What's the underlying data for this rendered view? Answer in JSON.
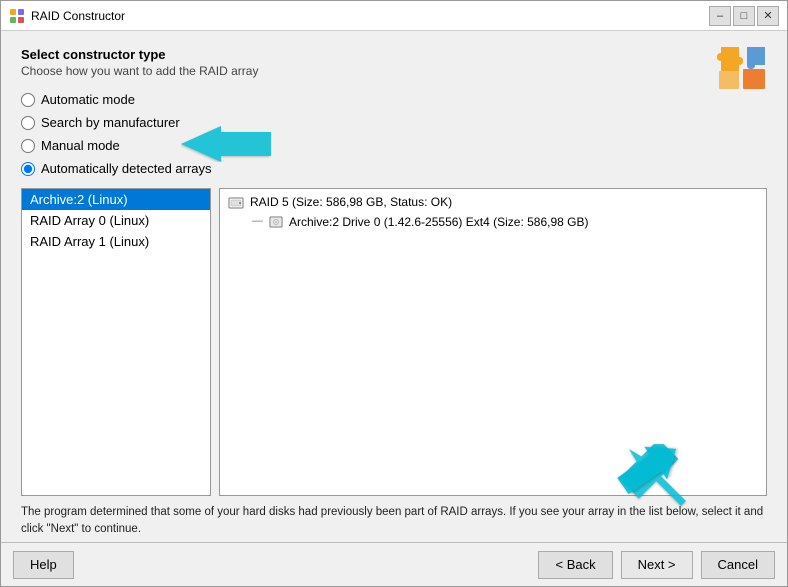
{
  "window": {
    "title": "RAID Constructor",
    "minimize_label": "–",
    "maximize_label": "□",
    "close_label": "✕"
  },
  "header": {
    "title": "Select constructor type",
    "subtitle": "Choose how you want to add the RAID array"
  },
  "radio_options": [
    {
      "id": "auto",
      "label": "Automatic mode",
      "checked": false
    },
    {
      "id": "manufacturer",
      "label": "Search by manufacturer",
      "checked": false
    },
    {
      "id": "manual",
      "label": "Manual mode",
      "checked": false
    },
    {
      "id": "detected",
      "label": "Automatically detected arrays",
      "checked": true
    }
  ],
  "list_items": [
    {
      "label": "Archive:2 (Linux)",
      "selected": true
    },
    {
      "label": "RAID Array 0 (Linux)",
      "selected": false
    },
    {
      "label": "RAID Array 1 (Linux)",
      "selected": false
    }
  ],
  "right_panel": {
    "top_item": "RAID 5 (Size: 586,98 GB, Status: OK)",
    "sub_item": "Archive:2 Drive 0 (1.42.6-25556) Ext4 (Size: 586,98 GB)"
  },
  "info_text": "The program determined that some of your hard disks had previously been part of RAID arrays. If you see your array in the list below, select it and click \"Next\" to continue.",
  "buttons": {
    "help": "Help",
    "back": "< Back",
    "next": "Next >",
    "cancel": "Cancel"
  }
}
